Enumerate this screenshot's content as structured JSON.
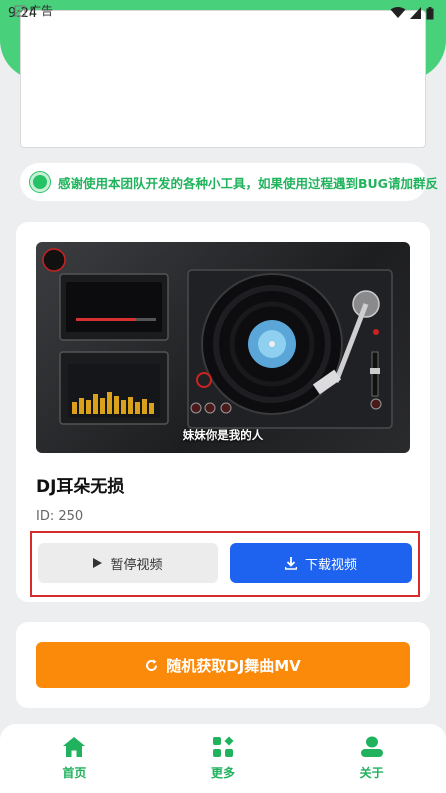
{
  "status_bar": {
    "time": "9:24"
  },
  "ad": {
    "label": "广告"
  },
  "notice": {
    "text": "感谢使用本团队开发的各种小工具，如果使用过程遇到BUG请加群反"
  },
  "video_card": {
    "caption": "妹妹你是我的人",
    "title": "DJ耳朵无损",
    "id_text": "ID: 250",
    "pause_label": "暂停视频",
    "download_label": "下载视频"
  },
  "random_button": {
    "label": "随机获取DJ舞曲MV"
  },
  "bottom_nav": {
    "items": [
      {
        "label": "首页",
        "icon": "home-icon"
      },
      {
        "label": "更多",
        "icon": "apps-icon"
      },
      {
        "label": "关于",
        "icon": "person-icon"
      }
    ]
  },
  "colors": {
    "primary_green": "#21b25e",
    "download_blue": "#1d63f0",
    "random_orange": "#fb8a0a",
    "highlight_red": "#d62c2c"
  }
}
